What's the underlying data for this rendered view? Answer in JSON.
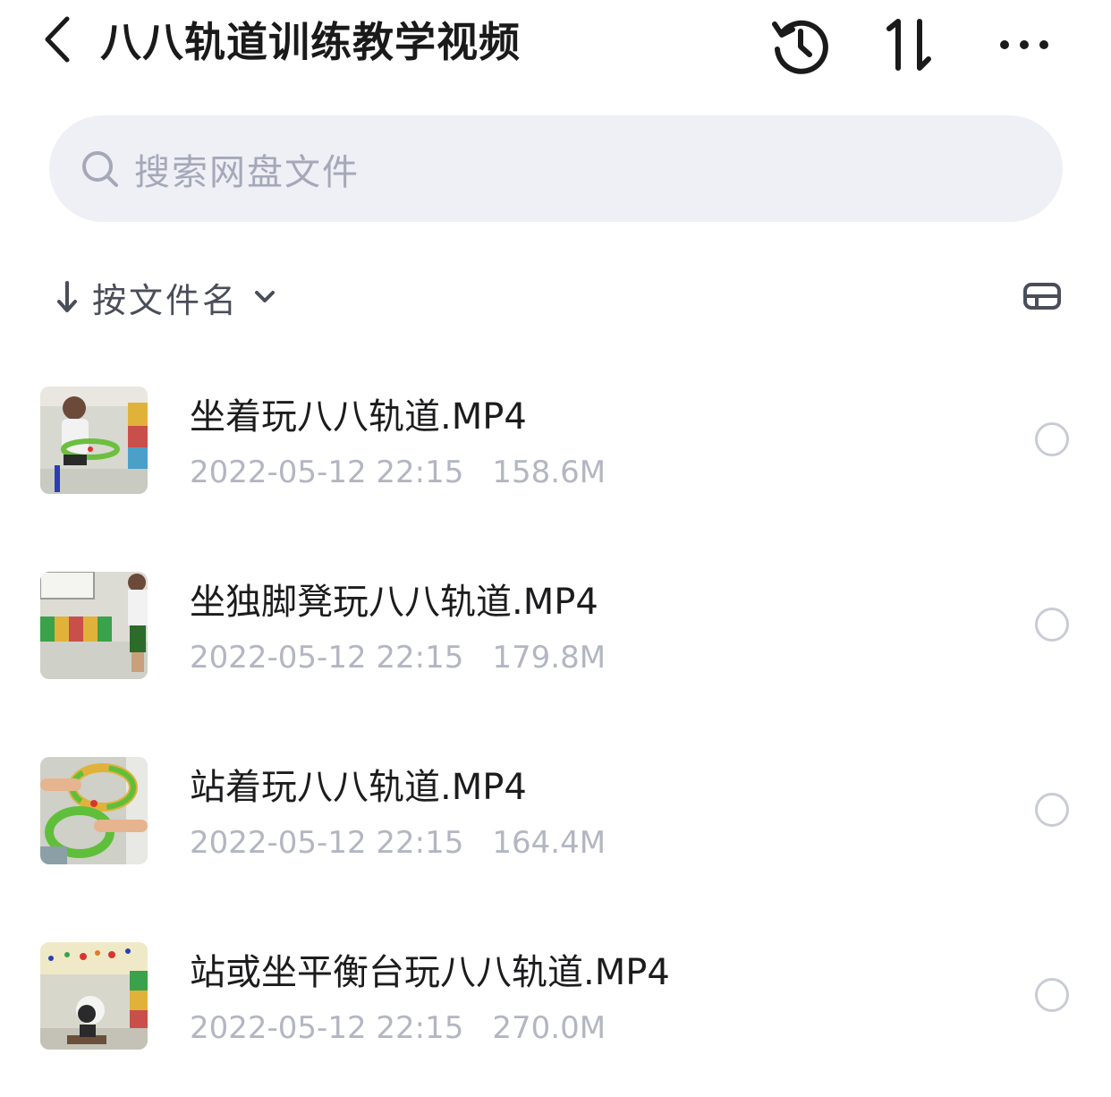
{
  "header": {
    "title": "八八轨道训练教学视频",
    "back_icon": "chevron-left-icon",
    "history_icon": "history-icon",
    "sort_icon": "sort-arrows-icon",
    "more_icon": "more-icon"
  },
  "search": {
    "placeholder": "搜索网盘文件",
    "icon": "search-icon"
  },
  "sort": {
    "label": "按文件名",
    "direction_icon": "arrow-down-icon",
    "chevron_icon": "chevron-down-icon",
    "view_icon": "list-view-icon"
  },
  "files": [
    {
      "name": "坐着玩八八轨道.MP4",
      "date": "2022-05-12 22:15",
      "size": "158.6M"
    },
    {
      "name": "坐独脚凳玩八八轨道.MP4",
      "date": "2022-05-12 22:15",
      "size": "179.8M"
    },
    {
      "name": "站着玩八八轨道.MP4",
      "date": "2022-05-12 22:15",
      "size": "164.4M"
    },
    {
      "name": "站或坐平衡台玩八八轨道.MP4",
      "date": "2022-05-12 22:15",
      "size": "270.0M"
    }
  ],
  "colors": {
    "search_bg": "#eef0f6",
    "placeholder": "#a4a8b8",
    "meta_text": "#b3b6c2",
    "circle_border": "#c9ccd5"
  }
}
